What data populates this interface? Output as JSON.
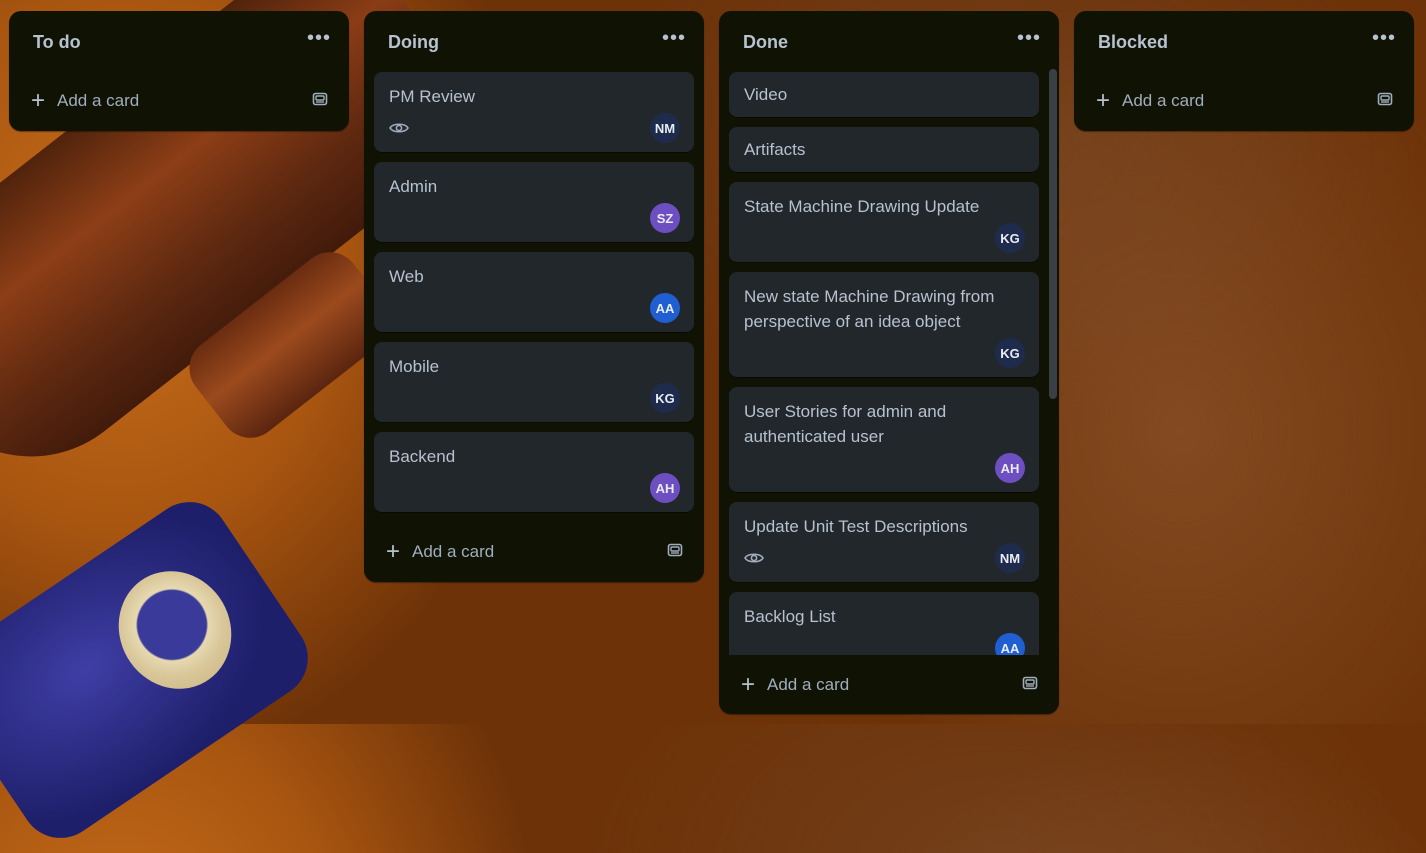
{
  "lists": [
    {
      "title": "To do",
      "menu": "•••",
      "cards": [],
      "add_label": "Add a card"
    },
    {
      "title": "Doing",
      "menu": "•••",
      "cards": [
        {
          "title": "PM Review",
          "watch": true,
          "avatar": "NM",
          "avatar_color": "#1f2b4d"
        },
        {
          "title": "Admin",
          "avatar": "SZ",
          "avatar_color": "#6e4fc1"
        },
        {
          "title": "Web",
          "avatar": "AA",
          "avatar_color": "#1f5fd1"
        },
        {
          "title": "Mobile",
          "avatar": "KG",
          "avatar_color": "#1f2b4d"
        },
        {
          "title": "Backend",
          "avatar": "AH",
          "avatar_color": "#6e4fc1"
        }
      ],
      "add_label": "Add a card"
    },
    {
      "title": "Done",
      "menu": "•••",
      "cards": [
        {
          "title": "Video"
        },
        {
          "title": "Artifacts"
        },
        {
          "title": "State Machine Drawing Update",
          "avatar": "KG",
          "avatar_color": "#1f2b4d"
        },
        {
          "title": "New state Machine Drawing from perspective of an idea object",
          "avatar": "KG",
          "avatar_color": "#1f2b4d"
        },
        {
          "title": "User Stories for admin and authenticated user",
          "avatar": "AH",
          "avatar_color": "#6e4fc1"
        },
        {
          "title": "Update Unit Test Descriptions",
          "watch": true,
          "avatar": "NM",
          "avatar_color": "#1f2b4d"
        },
        {
          "title": "Backlog List",
          "avatar": "AA",
          "avatar_color": "#1f5fd1"
        }
      ],
      "add_label": "Add a card"
    },
    {
      "title": "Blocked",
      "menu": "•••",
      "cards": [],
      "add_label": "Add a card"
    }
  ]
}
